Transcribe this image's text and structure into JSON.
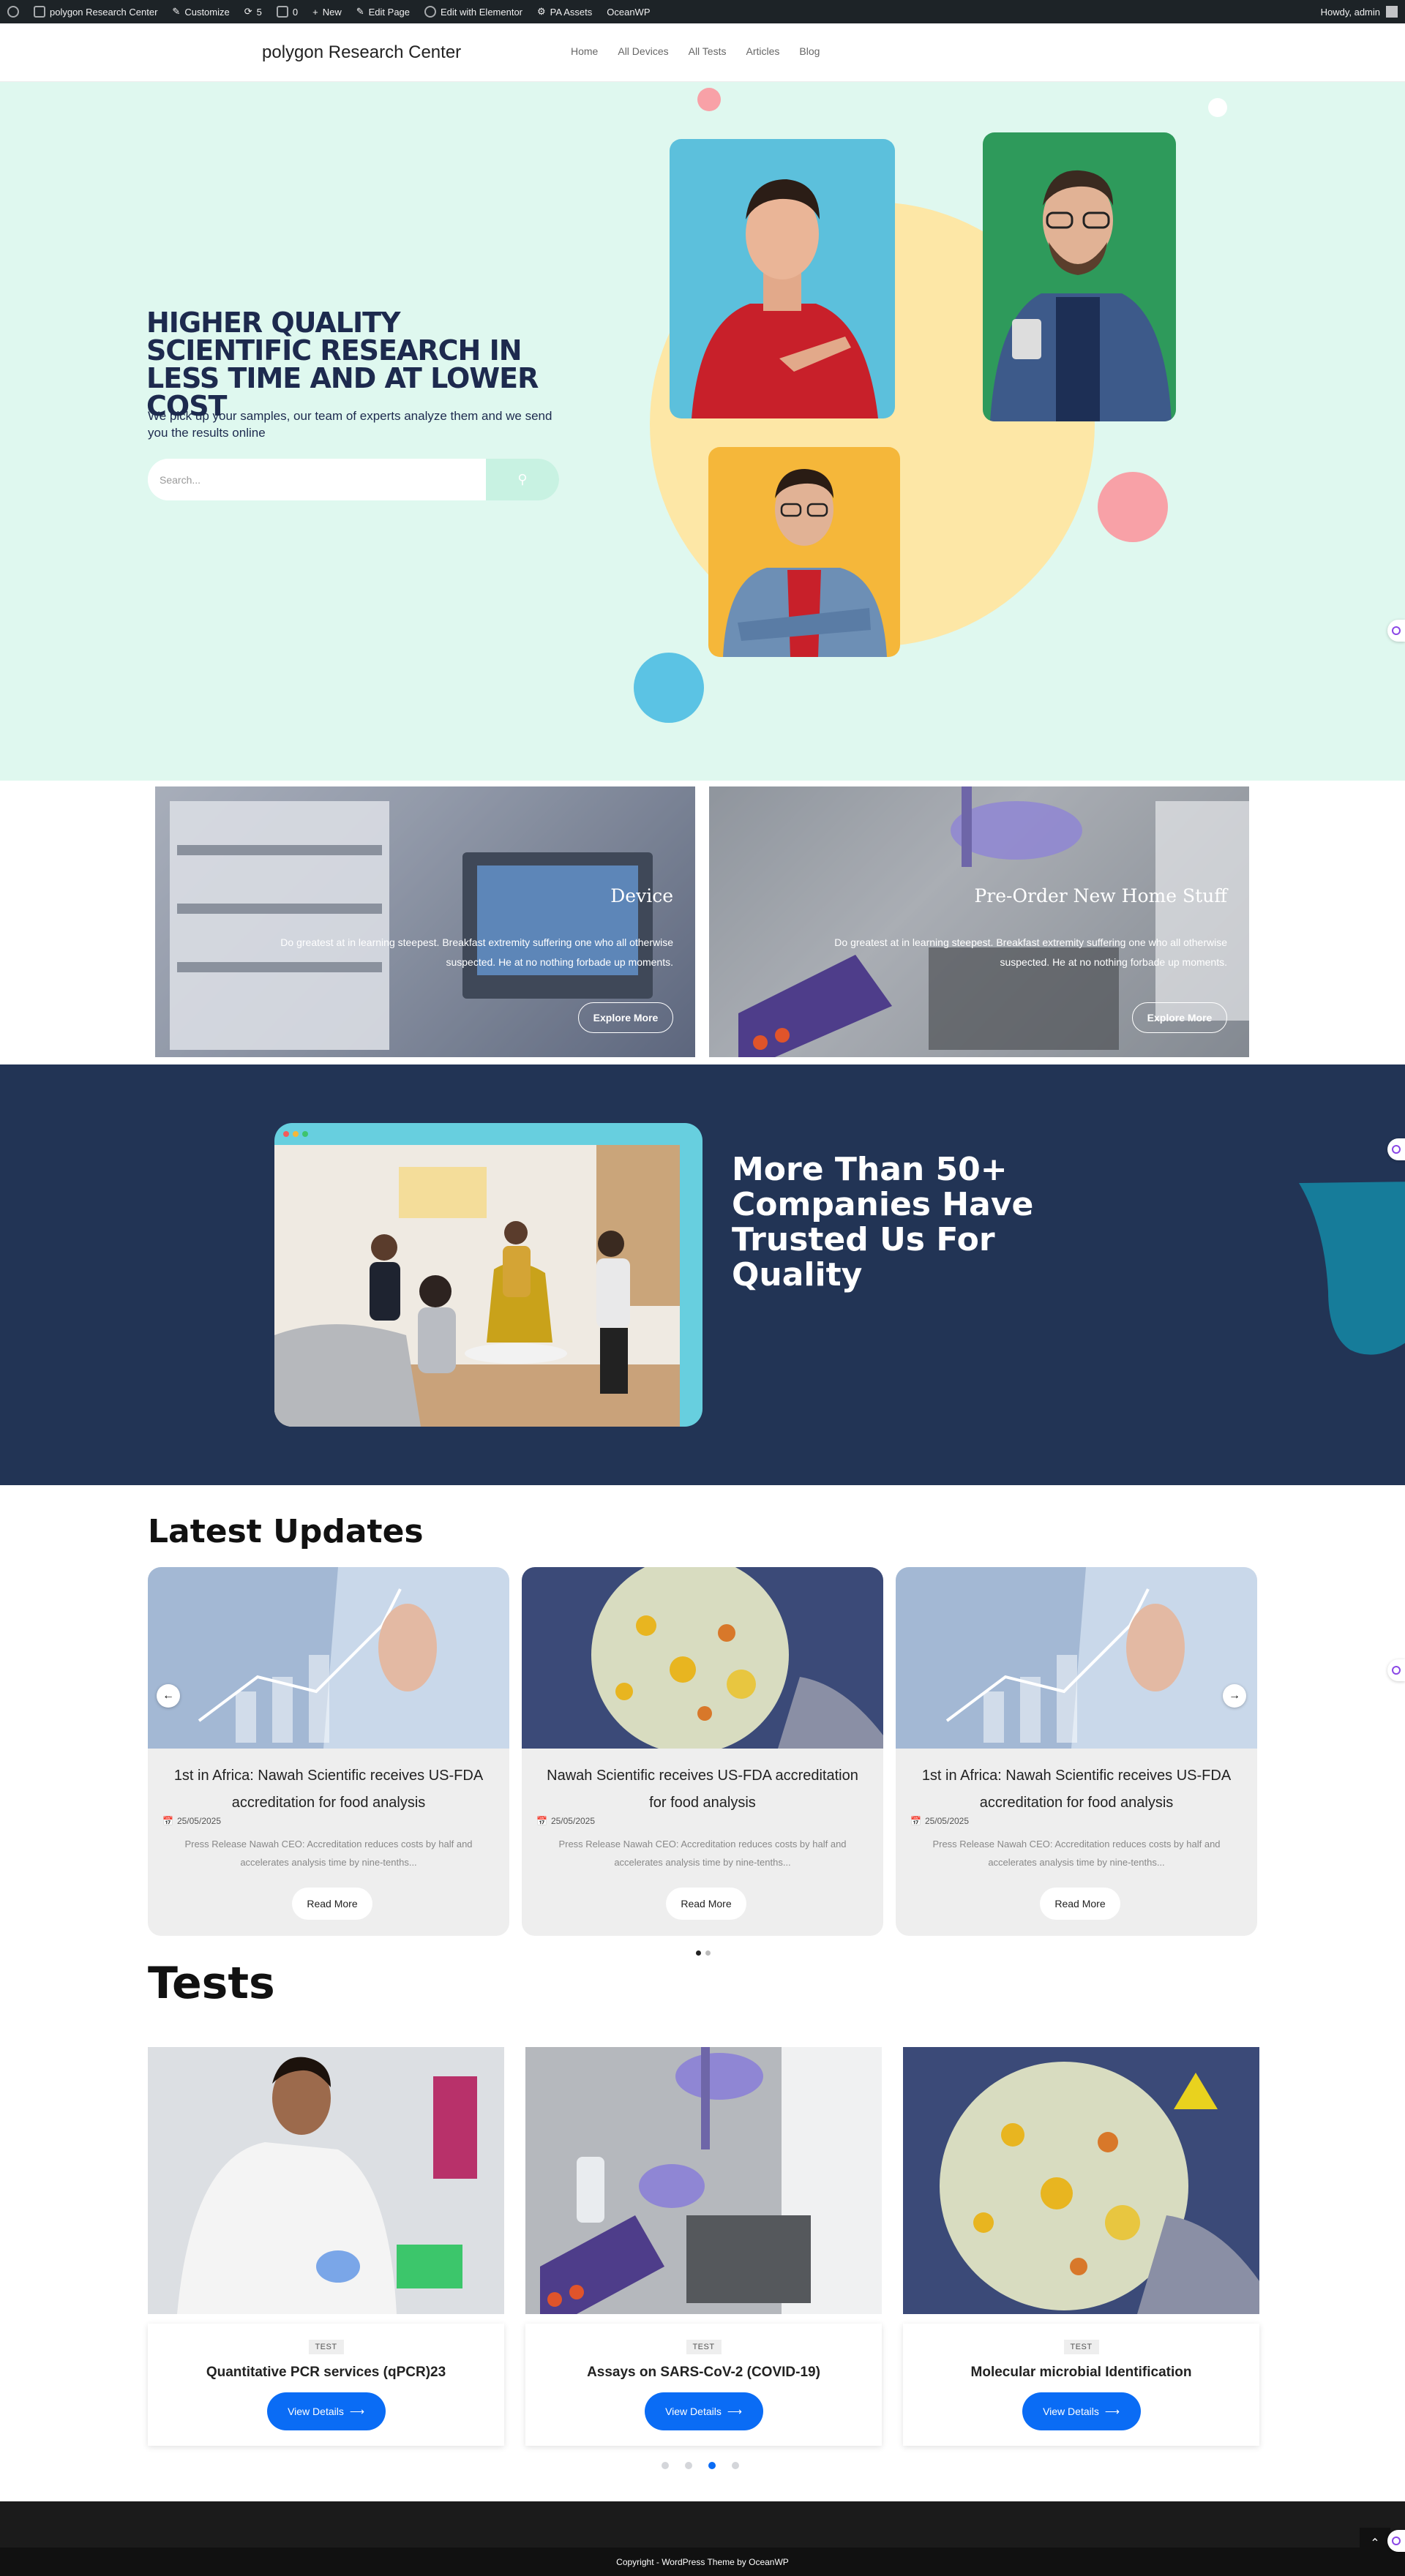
{
  "admin_bar": {
    "site_name": "polygon Research Center",
    "customize": "Customize",
    "updates_count": "5",
    "comments_count": "0",
    "new": "New",
    "edit_page": "Edit Page",
    "elementor": "Edit with Elementor",
    "pa_assets": "PA Assets",
    "oceanwp": "OceanWP",
    "howdy": "Howdy, admin"
  },
  "header": {
    "logo": "polygon Research Center",
    "nav": [
      "Home",
      "All Devices",
      "All Tests",
      "Articles",
      "Blog"
    ]
  },
  "hero": {
    "title": "HIGHER QUALITY SCIENTIFIC RESEARCH IN LESS TIME AND AT LOWER COST",
    "subtitle": "We pick up your samples, our team of experts analyze them and we send you the results online",
    "search_placeholder": "Search...",
    "search_icon": "search-icon",
    "colors": {
      "bg": "#dff8ef",
      "yellow": "#fde7a6",
      "pink": "#f8a1a7",
      "blue": "#5bc3e4",
      "navy": "#1d2a4e"
    }
  },
  "features": [
    {
      "title": "Device",
      "text": "Do greatest at in learning steepest. Breakfast extremity suffering one who all otherwise suspected. He at no nothing forbade up moments.",
      "button": "Explore More"
    },
    {
      "title": "Pre-Order New Home Stuff",
      "text": "Do greatest at in learning steepest. Breakfast extremity suffering one who all otherwise suspected. He at no nothing forbade up moments.",
      "button": "Explore More"
    }
  ],
  "trust": {
    "title": "More Than 50+ Companies Have Trusted Us For Quality",
    "colors": {
      "bg": "#223455",
      "frame": "#67cfdf",
      "accent": "#167c9a"
    }
  },
  "updates": {
    "heading": "Latest Updates",
    "items": [
      {
        "title": "1st in Africa: Nawah Scientific receives US-FDA accreditation for food analysis",
        "date": "25/05/2025",
        "excerpt": "Press Release Nawah CEO: Accreditation reduces costs by half and accelerates analysis time by nine-tenths...",
        "button": "Read More"
      },
      {
        "title": "Nawah Scientific receives US-FDA accreditation for food analysis",
        "date": "25/05/2025",
        "excerpt": "Press Release Nawah CEO: Accreditation reduces costs by half and accelerates analysis time by nine-tenths...",
        "button": "Read More"
      },
      {
        "title": "1st in Africa: Nawah Scientific receives US-FDA accreditation for food analysis",
        "date": "25/05/2025",
        "excerpt": "Press Release Nawah CEO: Accreditation reduces costs by half and accelerates analysis time by nine-tenths...",
        "button": "Read More"
      }
    ],
    "prev_icon": "arrow-left-icon",
    "next_icon": "arrow-right-icon",
    "active_page": 1,
    "page_count": 2
  },
  "tests": {
    "heading": "Tests",
    "items": [
      {
        "badge": "TEST",
        "name": "Quantitative PCR services (qPCR)23",
        "button": "View Details"
      },
      {
        "badge": "TEST",
        "name": "Assays on SARS-CoV-2 (COVID-19)",
        "button": "View Details"
      },
      {
        "badge": "TEST",
        "name": "Molecular microbial Identification",
        "button": "View Details"
      }
    ],
    "active_page": 3,
    "page_count": 4,
    "button_color": "#0a6cf5"
  },
  "footer": {
    "copyright": "Copyright - WordPress Theme by OceanWP"
  }
}
